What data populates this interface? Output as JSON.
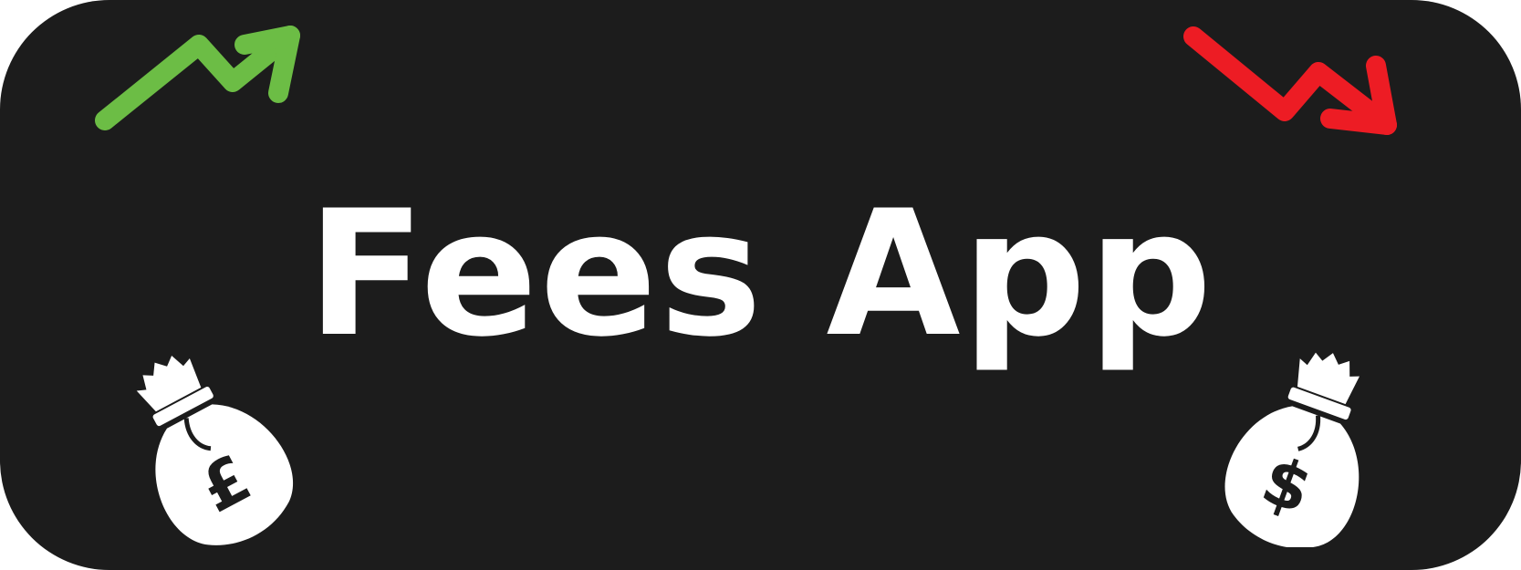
{
  "banner": {
    "title": "Fees App",
    "background_color": "#1c1c1c",
    "text_color": "#ffffff"
  },
  "icons": {
    "top_left": {
      "name": "trend-up-arrow-icon",
      "color": "#6cbd45"
    },
    "top_right": {
      "name": "trend-down-arrow-icon",
      "color": "#ed1c24"
    },
    "bottom_left": {
      "name": "pound-money-bag-icon",
      "color": "#ffffff",
      "glyph": "£"
    },
    "bottom_right": {
      "name": "dollar-money-bag-icon",
      "color": "#ffffff",
      "glyph": "$"
    }
  }
}
